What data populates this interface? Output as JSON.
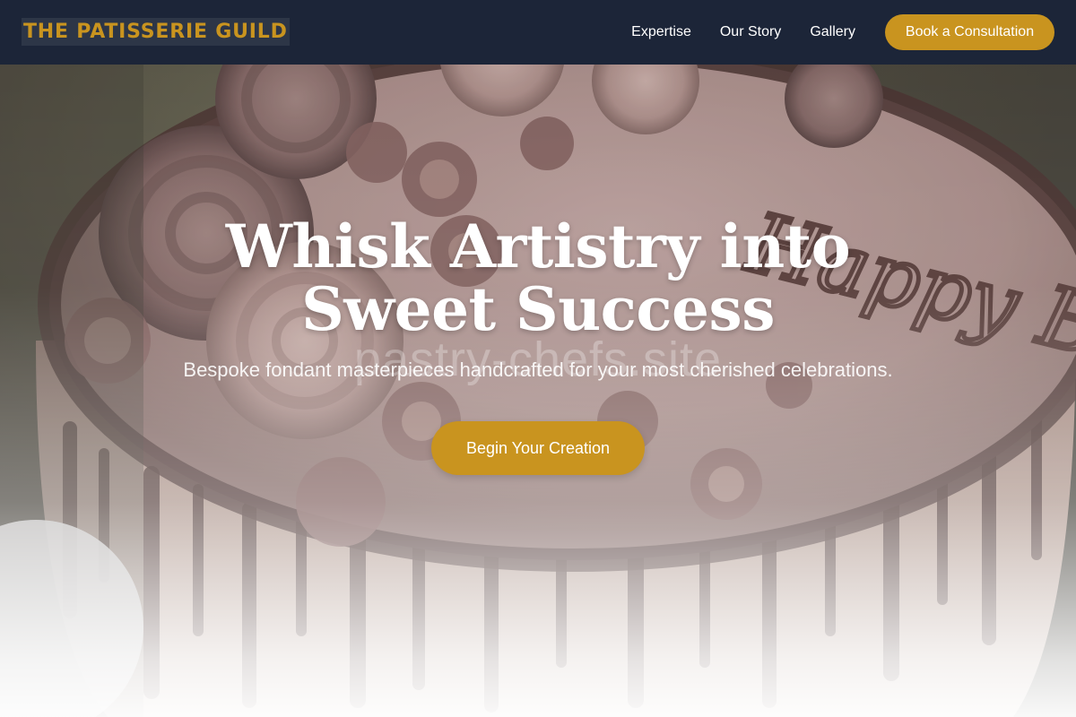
{
  "brand": {
    "name": "THE PATISSERIE GUILD"
  },
  "nav": {
    "links": [
      {
        "label": "Expertise"
      },
      {
        "label": "Our Story"
      },
      {
        "label": "Gallery"
      }
    ],
    "cta_label": "Book a Consultation"
  },
  "hero": {
    "title": "Whisk Artistry into Sweet Success",
    "subtitle": "Bespoke fondant masterpieces handcrafted for your most cherished celebrations.",
    "cta_label": "Begin Your Creation",
    "watermark": "pastry-chefs.site",
    "cake_inscription": "Happy Birthday"
  },
  "colors": {
    "nav_background": "#1c2538",
    "accent_gold": "#c9941f",
    "text_white": "#ffffff"
  }
}
